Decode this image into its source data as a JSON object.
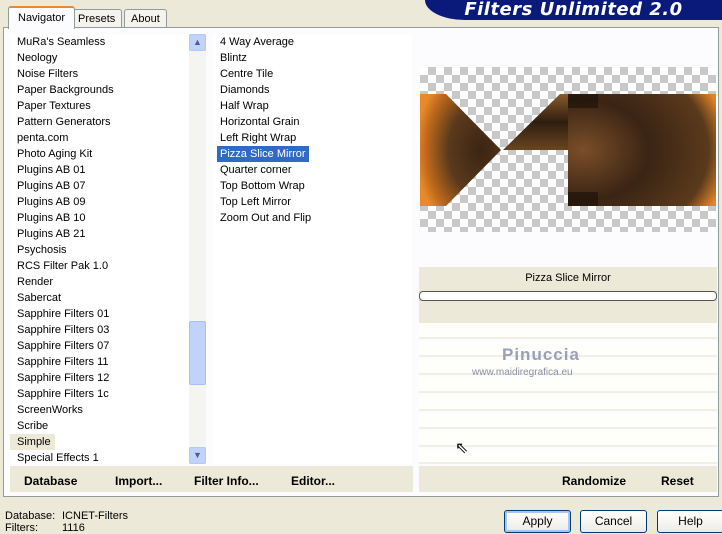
{
  "banner": {
    "title": "Filters Unlimited 2.0"
  },
  "tabs": [
    {
      "label": "Navigator",
      "active": true
    },
    {
      "label": "Presets"
    },
    {
      "label": "About"
    }
  ],
  "categories": {
    "items": [
      "MuRa's Seamless",
      "Neology",
      "Noise Filters",
      "Paper Backgrounds",
      "Paper Textures",
      "Pattern Generators",
      "penta.com",
      "Photo Aging Kit",
      "Plugins AB 01",
      "Plugins AB 07",
      "Plugins AB 09",
      "Plugins AB 10",
      "Plugins AB 21",
      "Psychosis",
      "RCS Filter Pak 1.0",
      "Render",
      "Sabercat",
      "Sapphire Filters 01",
      "Sapphire Filters 03",
      "Sapphire Filters 07",
      "Sapphire Filters 11",
      "Sapphire Filters 12",
      "Sapphire Filters 1c",
      "ScreenWorks",
      "Scribe",
      "Simple",
      "Special Effects 1"
    ],
    "selected": "Simple"
  },
  "filters": {
    "items": [
      "4 Way Average",
      "Blintz",
      "Centre Tile",
      "Diamonds",
      "Half Wrap",
      "Horizontal Grain",
      "Left Right Wrap",
      "Pizza Slice Mirror",
      "Quarter corner",
      "Top Bottom Wrap",
      "Top Left Mirror",
      "Zoom Out and Flip"
    ],
    "selected": "Pizza Slice Mirror"
  },
  "preview": {
    "filter_name": "Pizza Slice Mirror",
    "watermark_name": "Pinuccia",
    "watermark_url": "www.maidiregrafica.eu"
  },
  "left_toolbar": {
    "database": "Database",
    "import": "Import...",
    "filter_info": "Filter Info...",
    "editor": "Editor..."
  },
  "right_toolbar": {
    "randomize": "Randomize",
    "reset": "Reset"
  },
  "status": {
    "database_label": "Database:",
    "database_value": "ICNET-Filters",
    "filters_label": "Filters:",
    "filters_value": "1116"
  },
  "buttons": {
    "apply": "Apply",
    "cancel": "Cancel",
    "help": "Help"
  },
  "colors": {
    "selection": "#316ac5",
    "banner": "#0a1a7a",
    "tab_accent": "#e68b2c"
  }
}
